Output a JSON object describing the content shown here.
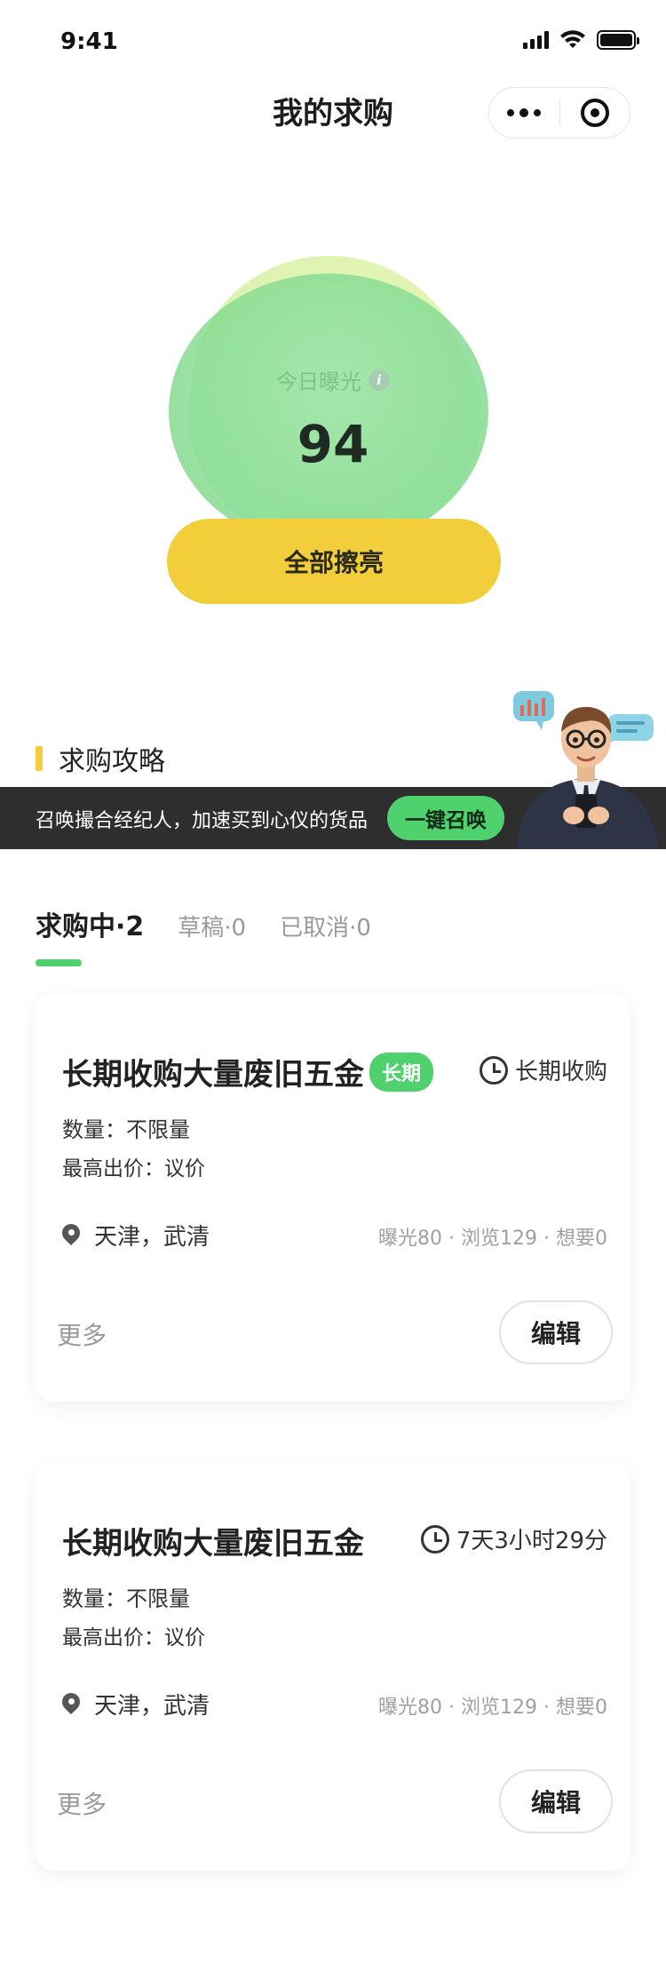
{
  "status_bar": {
    "time": "9:41"
  },
  "nav": {
    "title": "我的求购"
  },
  "exposure": {
    "label": "今日曝光",
    "value": "94",
    "brighten_label": "全部擦亮"
  },
  "guide": {
    "title": "求购攻略",
    "banner_text": "召唤撮合经纪人，加速买到心仪的货品",
    "summon_label": "一键召唤"
  },
  "tabs": [
    {
      "label": "求购中·2",
      "active": true
    },
    {
      "label": "草稿·0",
      "active": false
    },
    {
      "label": "已取消·0",
      "active": false
    }
  ],
  "cards": [
    {
      "title": "长期收购大量废旧五金",
      "tag": "长期",
      "period": "长期收购",
      "quantity": "数量：不限量",
      "price": "最高出价：议价",
      "location": "天津，武清",
      "stats": "曝光80 · 浏览129 · 想要0",
      "more": "更多",
      "edit": "编辑"
    },
    {
      "title": "长期收购大量废旧五金",
      "period": "7天3小时29分",
      "quantity": "数量：不限量",
      "price": "最高出价：议价",
      "location": "天津，武清",
      "stats": "曝光80 · 浏览129 · 想要0",
      "more": "更多",
      "edit": "编辑"
    }
  ],
  "colors": {
    "accent_green": "#4fd16d",
    "accent_yellow": "#f2ce3a",
    "banner_dark": "#2e2e2e"
  }
}
